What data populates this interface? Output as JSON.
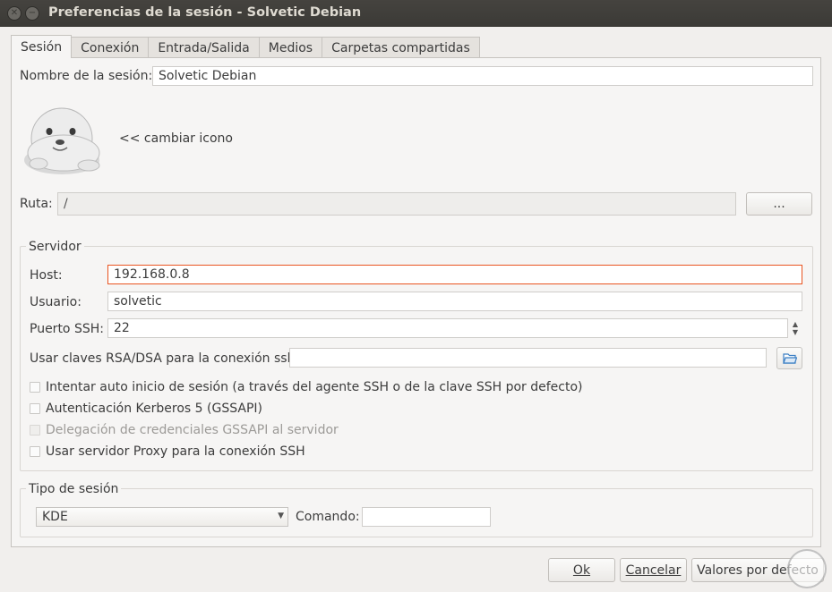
{
  "window": {
    "title": "Preferencias de la sesión - Solvetic Debian"
  },
  "tabs": [
    {
      "label": "Sesión",
      "active": true
    },
    {
      "label": "Conexión",
      "active": false
    },
    {
      "label": "Entrada/Salida",
      "active": false
    },
    {
      "label": "Medios",
      "active": false
    },
    {
      "label": "Carpetas compartidas",
      "active": false
    }
  ],
  "session": {
    "name_label": "Nombre de la sesión:",
    "name_value": "Solvetic Debian",
    "change_icon_label": "<< cambiar icono",
    "path_label": "Ruta:",
    "path_value": "/",
    "browse_label": "..."
  },
  "server": {
    "group_title": "Servidor",
    "host_label": "Host:",
    "host_value": "192.168.0.8",
    "user_label": "Usuario:",
    "user_value": "solvetic",
    "port_label": "Puerto SSH:",
    "port_value": "22",
    "rsa_label": "Usar claves RSA/DSA para la conexión ssh:",
    "rsa_value": "",
    "checkboxes": [
      {
        "label": "Intentar auto inicio de sesión (a través del agente SSH o de la clave SSH por defecto)",
        "checked": false,
        "enabled": true
      },
      {
        "label": "Autenticación Kerberos 5 (GSSAPI)",
        "checked": false,
        "enabled": true
      },
      {
        "label": "Delegación de credenciales GSSAPI al servidor",
        "checked": false,
        "enabled": false
      },
      {
        "label": "Usar servidor Proxy para la conexión SSH",
        "checked": false,
        "enabled": true
      }
    ]
  },
  "session_type": {
    "group_title": "Tipo de sesión",
    "selected": "KDE",
    "command_label": "Comando:",
    "command_value": ""
  },
  "footer": {
    "ok_label": "Ok",
    "cancel_label": "Cancelar",
    "defaults_label": "Valores por defecto"
  },
  "colors": {
    "focus": "#e95420",
    "titlebar": "#3c3b37",
    "folder_icon": "#3b7fc4"
  }
}
